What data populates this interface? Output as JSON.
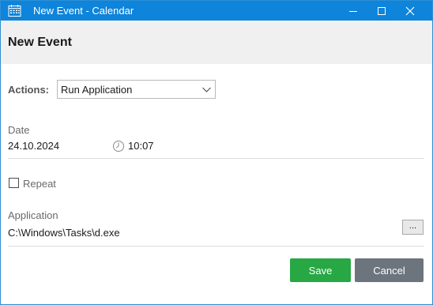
{
  "window": {
    "title": "New Event - Calendar",
    "controls": {
      "minimize": "minimize-icon",
      "maximize": "maximize-icon",
      "close": "close-icon"
    }
  },
  "header": {
    "title": "New Event"
  },
  "form": {
    "actions": {
      "label": "Actions:",
      "selected": "Run Application"
    },
    "date": {
      "label": "Date",
      "value": "24.10.2024",
      "time": "10:07"
    },
    "repeat": {
      "label": "Repeat",
      "checked": false
    },
    "application": {
      "label": "Application",
      "path": "C:\\Windows\\Tasks\\d.exe",
      "browse_label": "..."
    }
  },
  "buttons": {
    "save": "Save",
    "cancel": "Cancel"
  },
  "colors": {
    "titlebar": "#0e84da",
    "save": "#27a844",
    "cancel": "#6c757d"
  }
}
